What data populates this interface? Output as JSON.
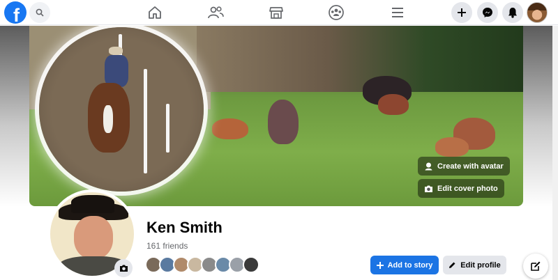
{
  "nav": {
    "logo_letter": "f",
    "icons": [
      "search-icon",
      "home-icon",
      "friends-icon",
      "marketplace-icon",
      "groups-icon",
      "menu-icon",
      "plus-icon",
      "messenger-icon",
      "bell-icon"
    ]
  },
  "cover": {
    "create_avatar_label": "Create with avatar",
    "edit_cover_label": "Edit cover photo"
  },
  "profile": {
    "name": "Ken Smith",
    "friends_count": "161 friends",
    "add_story_label": "Add to story",
    "edit_profile_label": "Edit profile"
  },
  "colors": {
    "brand": "#1877f2",
    "primary_button": "#1b74e4",
    "secondary_button": "#e4e6eb"
  }
}
